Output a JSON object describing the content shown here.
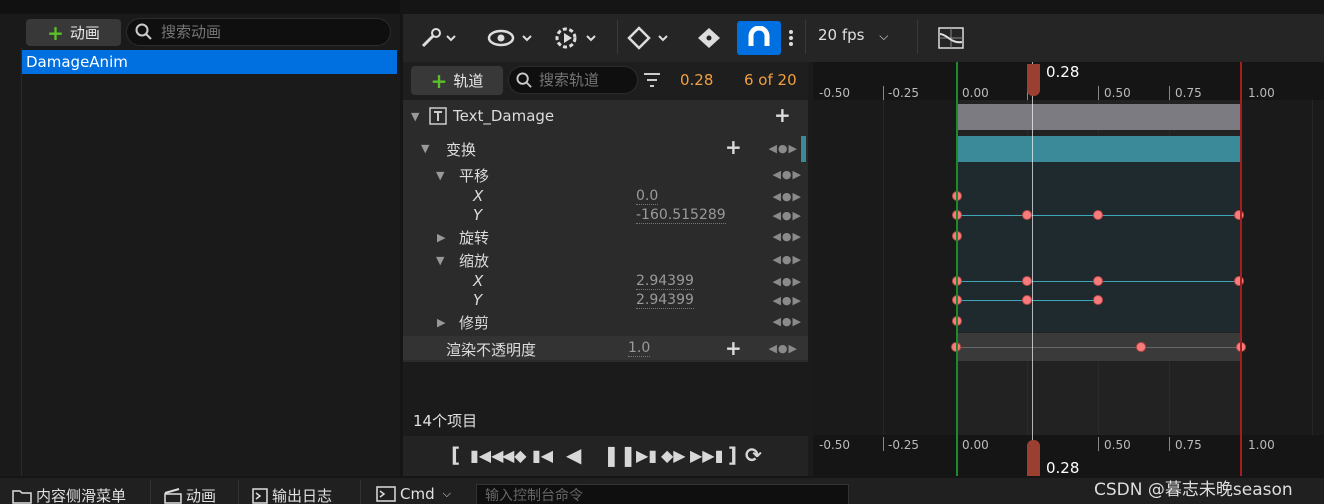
{
  "animations_panel": {
    "add_label": "动画",
    "search_placeholder": "搜索动画",
    "items": [
      "DamageAnim"
    ]
  },
  "toolbar": {
    "fps": "20 fps"
  },
  "track_header": {
    "add_label": "轨道",
    "search_placeholder": "搜索轨道",
    "current_time": "0.28",
    "frame_counter": "6 of 20"
  },
  "outliner": {
    "object_name": "Text_Damage",
    "transform": "变换",
    "translation": "平移",
    "tx_label": "X",
    "tx_value": "0.0",
    "ty_label": "Y",
    "ty_value": "-160.515289",
    "rotation": "旋转",
    "scale": "缩放",
    "sx_label": "X",
    "sx_value": "2.94399",
    "sy_label": "Y",
    "sy_value": "2.94399",
    "shear": "修剪",
    "opacity": "渲染不透明度",
    "opacity_value": "1.0",
    "item_count": "14个项目"
  },
  "timeline": {
    "ticks": [
      "-0.50",
      "-0.25",
      "0.00",
      "0.25",
      "0.50",
      "0.75",
      "1.00"
    ],
    "playhead_label": "0.28",
    "colors": {
      "section": "#7c7b82",
      "transform_lane": "#3a8a99",
      "key": "#f87c7c",
      "curve": "#3fa7b7"
    }
  },
  "bottombar": {
    "content_drawer": "内容侧滑菜单",
    "animation": "动画",
    "output_log": "输出日志",
    "cmd": "Cmd",
    "console_placeholder": "输入控制台命令"
  },
  "watermark": "CSDN @暮志未晚season"
}
